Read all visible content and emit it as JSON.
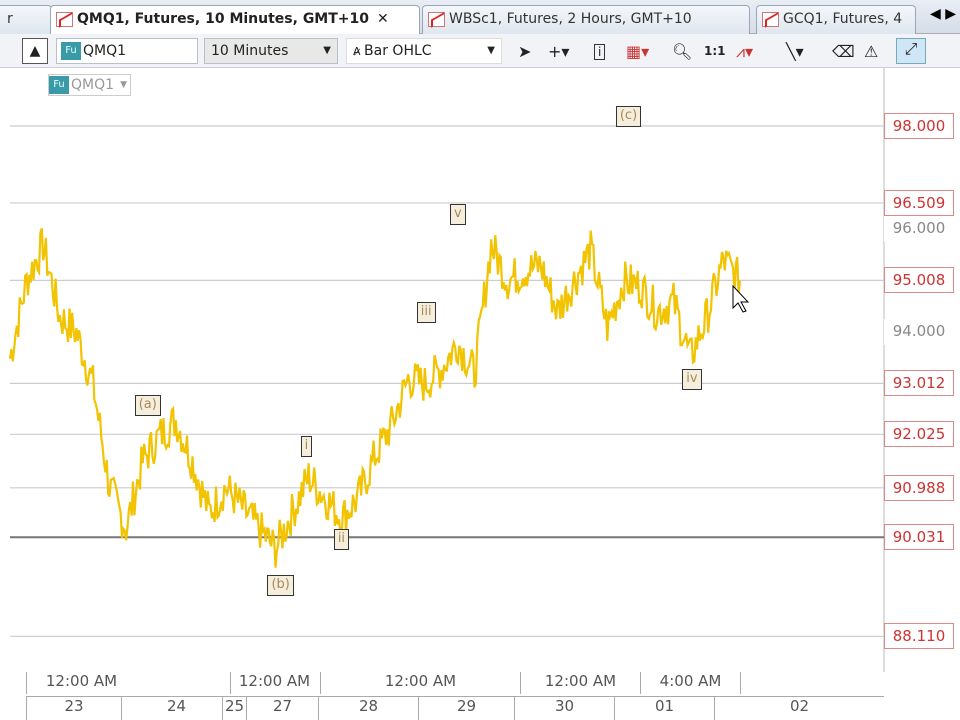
{
  "tabs": [
    {
      "label": "r"
    },
    {
      "label": "QMQ1, Futures, 10 Minutes, GMT+10",
      "close": "✕",
      "active": true
    },
    {
      "label": "WBSc1, Futures, 2 Hours, GMT+10"
    },
    {
      "label": "GCQ1, Futures, 4"
    }
  ],
  "tab_scroll": "◀ ▶",
  "toolbar": {
    "symbol": "QMQ1",
    "fu_badge": "Fu",
    "interval": "10 Minutes",
    "chart_type": "Bar OHLC",
    "zoom_ratio": "1:1"
  },
  "chart_symbol": "QMQ1",
  "price_labels": [
    {
      "value": "98.000",
      "boxed": true,
      "p": 98.0
    },
    {
      "value": "96.509",
      "boxed": true,
      "p": 96.509
    },
    {
      "value": "96.000",
      "boxed": false,
      "p": 96.0
    },
    {
      "value": "95.008",
      "boxed": true,
      "p": 95.008
    },
    {
      "value": "94.000",
      "boxed": false,
      "p": 94.0
    },
    {
      "value": "93.012",
      "boxed": true,
      "p": 93.012
    },
    {
      "value": "92.025",
      "boxed": true,
      "p": 92.025
    },
    {
      "value": "90.988",
      "boxed": true,
      "p": 90.988
    },
    {
      "value": "90.031",
      "boxed": true,
      "p": 90.031
    },
    {
      "value": "88.110",
      "boxed": true,
      "p": 88.11
    }
  ],
  "wave_labels": [
    {
      "text": "(a)",
      "i": 8,
      "p": 92.6
    },
    {
      "text": "(b)",
      "i": 16,
      "p": 89.1
    },
    {
      "text": "(c)",
      "i": 37,
      "p": 98.2
    },
    {
      "text": "i",
      "i": 18,
      "p": 91.8
    },
    {
      "text": "ii",
      "i": 20,
      "p": 90.0
    },
    {
      "text": "iii",
      "i": 25,
      "p": 94.4
    },
    {
      "text": "v",
      "i": 27,
      "p": 96.3
    },
    {
      "text": "iv",
      "i": 41,
      "p": 93.1
    }
  ],
  "time_axis": {
    "top": [
      "12:00 AM",
      "12:00 AM",
      "12:00 AM",
      "12:00 AM",
      "4:00 AM",
      ""
    ],
    "bottom": [
      "23",
      "24",
      "25",
      "27",
      "28",
      "29",
      "30",
      "01",
      "02"
    ]
  },
  "chart_data": {
    "type": "line",
    "color": "#f2c300",
    "ylim": [
      87.0,
      99.5
    ],
    "values": [
      93.5,
      95,
      95.7,
      94.3,
      94,
      93,
      91,
      90.2,
      91.5,
      92,
      92.3,
      91.5,
      90.5,
      91,
      90.6,
      90.2,
      89.8,
      90.5,
      91.2,
      90.8,
      90.4,
      90.8,
      91.6,
      92.2,
      93.1,
      93,
      93.3,
      93.8,
      93.2,
      95.7,
      95,
      95.2,
      95.3,
      94.4,
      95,
      95.6,
      94.1,
      95,
      94.9,
      94.4,
      94.6,
      93.5,
      94.3,
      95.4,
      95
    ]
  }
}
